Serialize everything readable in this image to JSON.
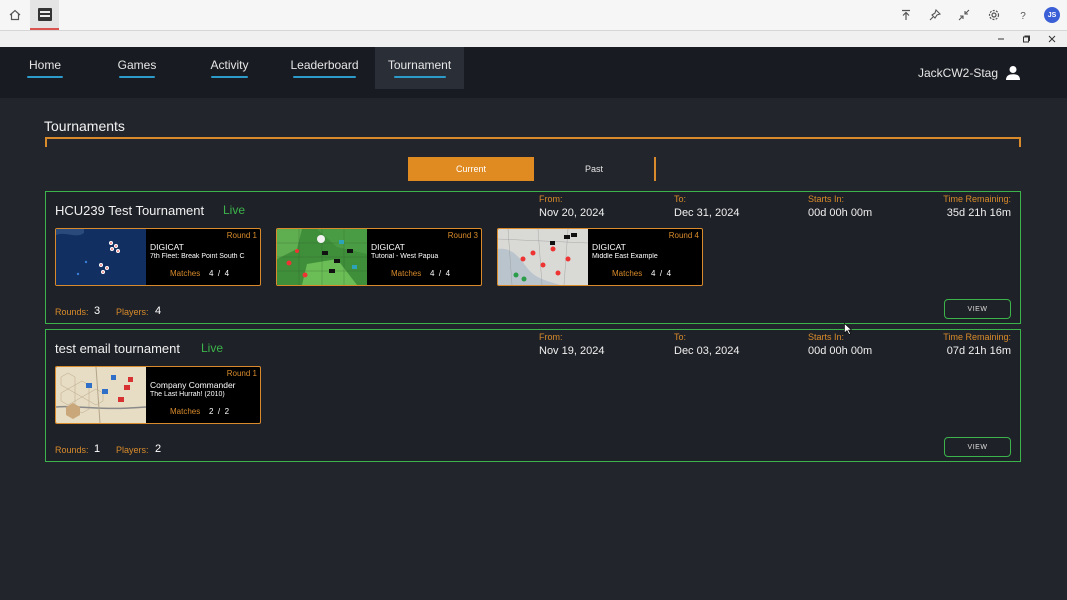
{
  "app": {
    "avatar_initials": "JS"
  },
  "nav": {
    "items": [
      {
        "label": "Home"
      },
      {
        "label": "Games"
      },
      {
        "label": "Activity"
      },
      {
        "label": "Leaderboard"
      },
      {
        "label": "Tournament"
      }
    ],
    "active": "Tournament",
    "user_name": "JackCW2-Stag"
  },
  "page": {
    "title": "Tournaments",
    "tabs": {
      "current": "Current",
      "past": "Past"
    }
  },
  "labels": {
    "from": "From:",
    "to": "To:",
    "starts_in": "Starts In:",
    "time_remaining": "Time Remaining:",
    "rounds": "Rounds:",
    "players": "Players:",
    "matches": "Matches",
    "match_sep": "/",
    "view": "VIEW"
  },
  "tournaments": [
    {
      "name": "HCU239 Test Tournament",
      "status": "Live",
      "from": "Nov 20, 2024",
      "to": "Dec 31, 2024",
      "starts_in": "00d 00h 00m",
      "time_remaining": "35d 21h 16m",
      "rounds": "3",
      "players": "4",
      "cards": [
        {
          "round": "Round 1",
          "game": "DIGICAT",
          "scenario": "7th Fleet: Break Point South C",
          "matches_done": "4",
          "matches_total": "4"
        },
        {
          "round": "Round 3",
          "game": "DIGICAT",
          "scenario": "Tutorial - West Papua",
          "matches_done": "4",
          "matches_total": "4"
        },
        {
          "round": "Round 4",
          "game": "DIGICAT",
          "scenario": "Middle East Example",
          "matches_done": "4",
          "matches_total": "4"
        }
      ]
    },
    {
      "name": "test email tournament",
      "status": "Live",
      "from": "Nov 19, 2024",
      "to": "Dec 03, 2024",
      "starts_in": "00d 00h 00m",
      "time_remaining": "07d 21h 16m",
      "rounds": "1",
      "players": "2",
      "cards": [
        {
          "round": "Round 1",
          "game": "Company Commander",
          "scenario": "The Last Hurrah! (2010)",
          "matches_done": "2",
          "matches_total": "2"
        }
      ]
    }
  ]
}
